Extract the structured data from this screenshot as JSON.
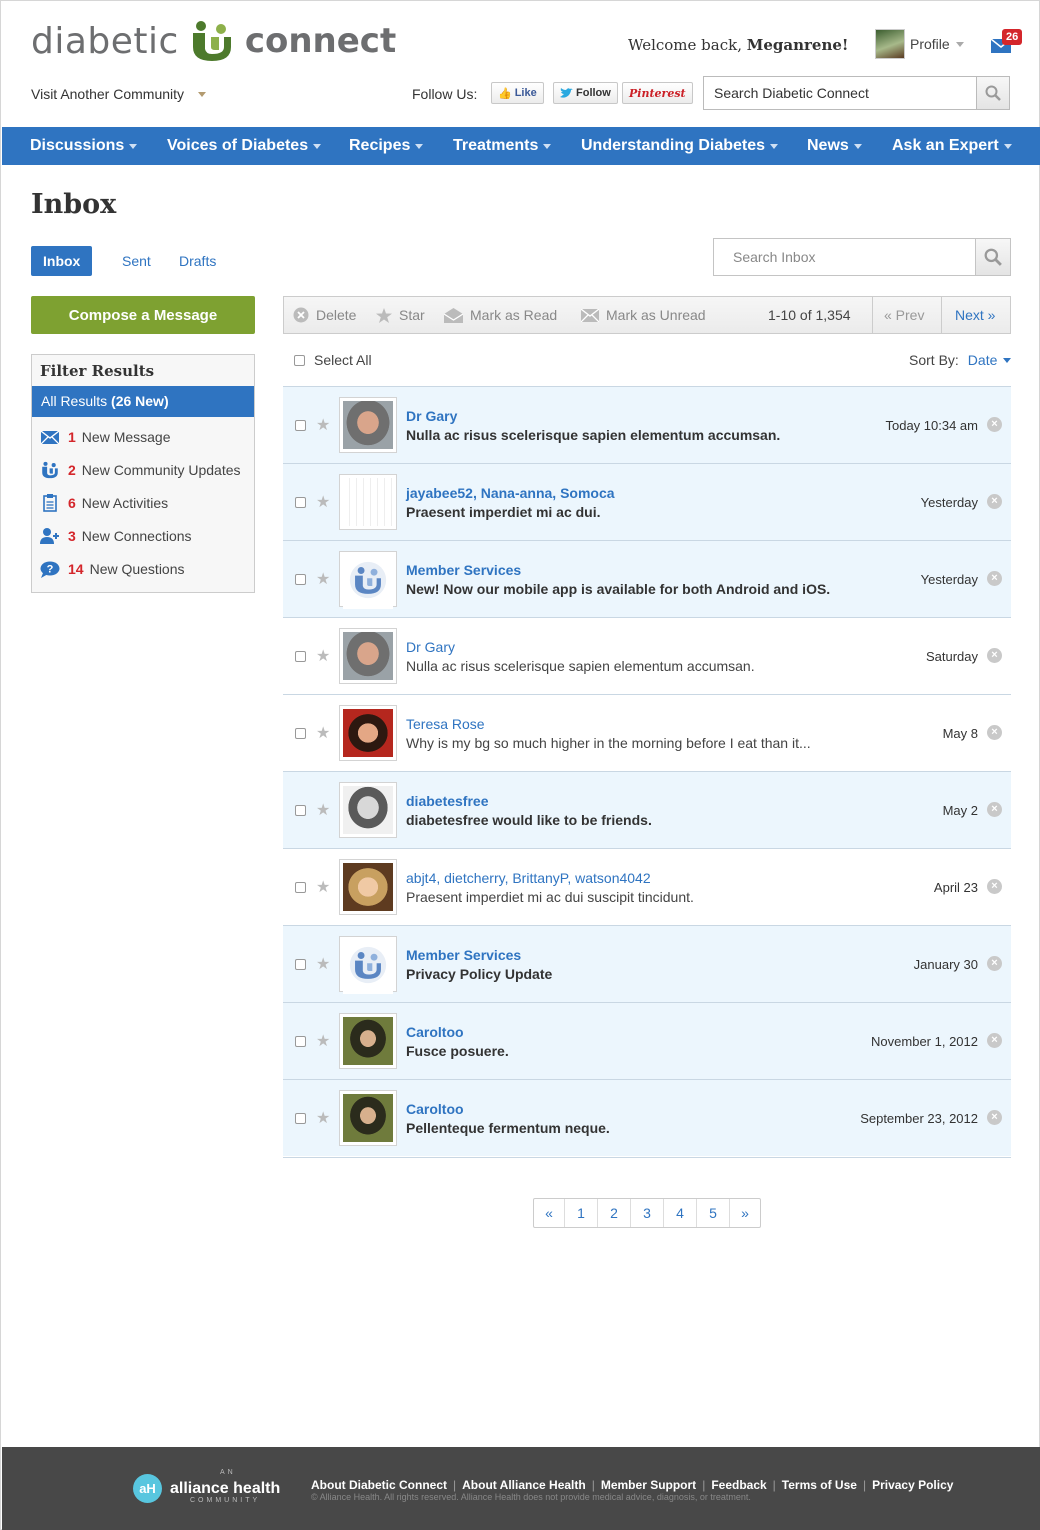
{
  "header": {
    "logo_word1": "diabetic",
    "logo_word2": "connect",
    "welcome_prefix": "Welcome back,",
    "username": "Meganrene!",
    "profile_label": "Profile",
    "mail_count": "26",
    "visit_community": "Visit Another Community",
    "follow_us": "Follow Us:",
    "like": "Like",
    "follow": "Follow",
    "pinterest": "Pinterest",
    "search_value": "Search Diabetic Connect"
  },
  "nav": [
    "Discussions",
    "Voices of Diabetes",
    "Recipes",
    "Treatments",
    "Understanding Diabetes",
    "News",
    "Ask an Expert"
  ],
  "page_title": "Inbox",
  "tabs": [
    "Inbox",
    "Sent",
    "Drafts"
  ],
  "search_inbox_placeholder": "Search Inbox",
  "compose_label": "Compose a Message",
  "filter": {
    "title": "Filter Results",
    "all_label": "All Results",
    "all_new": "(26 New)",
    "items": [
      {
        "count": "1",
        "label": "New Message",
        "icon": "envelope-icon"
      },
      {
        "count": "2",
        "label": "New Community Updates",
        "icon": "community-icon"
      },
      {
        "count": "6",
        "label": "New Activities",
        "icon": "clipboard-icon"
      },
      {
        "count": "3",
        "label": "New Connections",
        "icon": "add-user-icon"
      },
      {
        "count": "14",
        "label": "New Questions",
        "icon": "question-bubble-icon"
      }
    ]
  },
  "toolbar": {
    "delete": "Delete",
    "star": "Star",
    "mark_read": "Mark as Read",
    "mark_unread": "Mark as Unread",
    "range": "1-10 of 1,354",
    "prev": "« Prev",
    "next": "Next »"
  },
  "select_all": "Select All",
  "sort_by": "Sort By:",
  "sort_value": "Date",
  "messages": [
    {
      "from": "Dr Gary",
      "subject": "Nulla ac risus scelerisque sapien elementum accumsan.",
      "date": "Today 10:34 am",
      "unread": true,
      "avatar": "img-gary"
    },
    {
      "from": "jayabee52, Nana-anna, Somoca",
      "subject": "Praesent imperdiet mi ac dui.",
      "date": "Yesterday",
      "unread": true,
      "avatar": "img-cartoon"
    },
    {
      "from": "Member Services",
      "subject": "New! Now our mobile app is available for both Android and iOS.",
      "date": "Yesterday",
      "unread": true,
      "avatar": "img-ms"
    },
    {
      "from": "Dr Gary",
      "subject": "Nulla ac risus scelerisque sapien elementum accumsan.",
      "date": "Saturday",
      "unread": false,
      "avatar": "img-gary"
    },
    {
      "from": "Teresa Rose",
      "subject": "Why is my bg so much higher in the morning before I eat than it...",
      "date": "May 8",
      "unread": false,
      "avatar": "img-teresa"
    },
    {
      "from": "diabetesfree",
      "subject": "diabetesfree would like to be friends.",
      "date": "May 2",
      "unread": true,
      "avatar": "img-df"
    },
    {
      "from": "abjt4, dietcherry, BrittanyP, watson4042",
      "subject": "Praesent imperdiet mi ac dui suscipit tincidunt.",
      "date": "April 23",
      "unread": false,
      "avatar": "img-abjt"
    },
    {
      "from": "Member Services",
      "subject": "Privacy Policy Update",
      "date": "January 30",
      "unread": true,
      "avatar": "img-ms"
    },
    {
      "from": "Caroltoo",
      "subject": "Fusce posuere.",
      "date": "November 1, 2012",
      "unread": true,
      "avatar": "img-carol"
    },
    {
      "from": "Caroltoo",
      "subject": "Pellenteque fermentum neque.",
      "date": "September 23, 2012",
      "unread": true,
      "avatar": "img-carol"
    }
  ],
  "pagination": [
    "«",
    "1",
    "2",
    "3",
    "4",
    "5",
    "»"
  ],
  "footer": {
    "ah_an": "AN",
    "ah_name": "alliance health",
    "ah_community": "COMMUNITY",
    "links": [
      "About Diabetic Connect",
      "About Alliance Health",
      "Member Support",
      "Feedback",
      "Terms of Use",
      "Privacy Policy"
    ],
    "copyright": "© Alliance Health. All rights reserved. Alliance Health does not provide medical advice, diagnosis, or treatment."
  },
  "colors": {
    "brand_blue": "#2f74c1",
    "compose_green": "#7ea131",
    "badge_red": "#d4262b",
    "unread_bg": "#ecf6fd"
  }
}
